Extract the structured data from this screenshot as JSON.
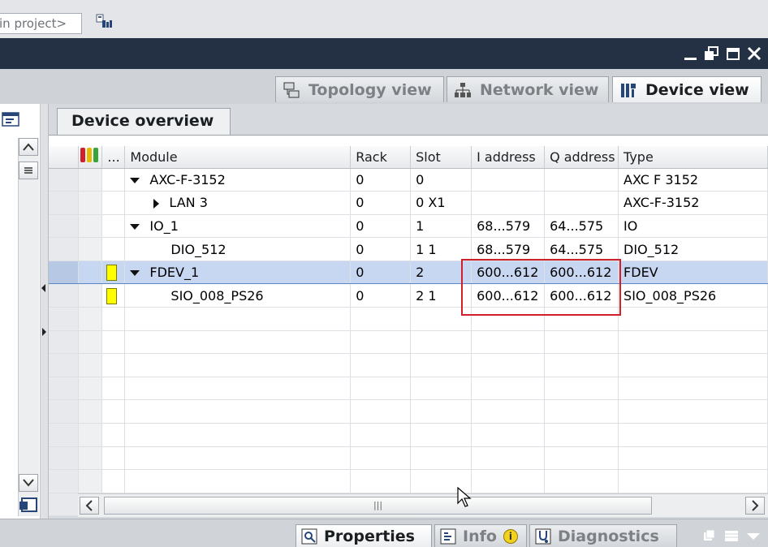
{
  "toolbar": {
    "search_placeholder": "in project>",
    "search_icon": "network-search-icon"
  },
  "window": {
    "buttons": [
      "minimize-icon",
      "restore-icon",
      "maximize-icon",
      "close-icon"
    ]
  },
  "view_tabs": [
    {
      "label": "Topology view",
      "icon": "topology-icon",
      "active": false
    },
    {
      "label": "Network view",
      "icon": "network-icon",
      "active": false
    },
    {
      "label": "Device view",
      "icon": "device-icon",
      "active": true
    }
  ],
  "overview": {
    "tab_label": "Device overview",
    "columns": [
      "",
      "...",
      "Module",
      "Rack",
      "Slot",
      "I address",
      "Q address",
      "Type"
    ],
    "rows": [
      {
        "module": "AXC-F-3152",
        "rack": "0",
        "slot": "0",
        "i_address": "",
        "q_address": "",
        "type": "AXC F 3152",
        "expander": "expanded",
        "indent": 0,
        "status": ""
      },
      {
        "module": "LAN 3",
        "rack": "0",
        "slot": "0 X1",
        "i_address": "",
        "q_address": "",
        "type": "AXC-F-3152",
        "expander": "collapsed",
        "indent": 1,
        "status": ""
      },
      {
        "module": "IO_1",
        "rack": "0",
        "slot": "1",
        "i_address": "68...579",
        "q_address": "64...575",
        "type": "IO",
        "expander": "expanded",
        "indent": 0,
        "status": ""
      },
      {
        "module": "DIO_512",
        "rack": "0",
        "slot": "1 1",
        "i_address": "68...579",
        "q_address": "64...575",
        "type": "DIO_512",
        "expander": "none",
        "indent": 1,
        "status": ""
      },
      {
        "module": "FDEV_1",
        "rack": "0",
        "slot": "2",
        "i_address": "600...612",
        "q_address": "600...612",
        "type": "FDEV",
        "expander": "expanded",
        "indent": 0,
        "status": "yellow",
        "selected": true
      },
      {
        "module": "SIO_008_PS26",
        "rack": "0",
        "slot": "2 1",
        "i_address": "600...612",
        "q_address": "600...612",
        "type": "SIO_008_PS26",
        "expander": "none",
        "indent": 1,
        "status": "yellow"
      }
    ],
    "empty_rows": 9
  },
  "bottom_tabs": [
    {
      "label": "Properties",
      "icon": "properties-icon",
      "active": true
    },
    {
      "label": "Info",
      "icon": "info-icon",
      "active": false,
      "badge": "i"
    },
    {
      "label": "Diagnostics",
      "icon": "diagnostics-icon",
      "active": false
    }
  ],
  "colors": {
    "title_bar": "#243044",
    "selection": "#c7d7f1",
    "highlight_box": "#d0202a",
    "status_yellow": "#ffff00"
  }
}
